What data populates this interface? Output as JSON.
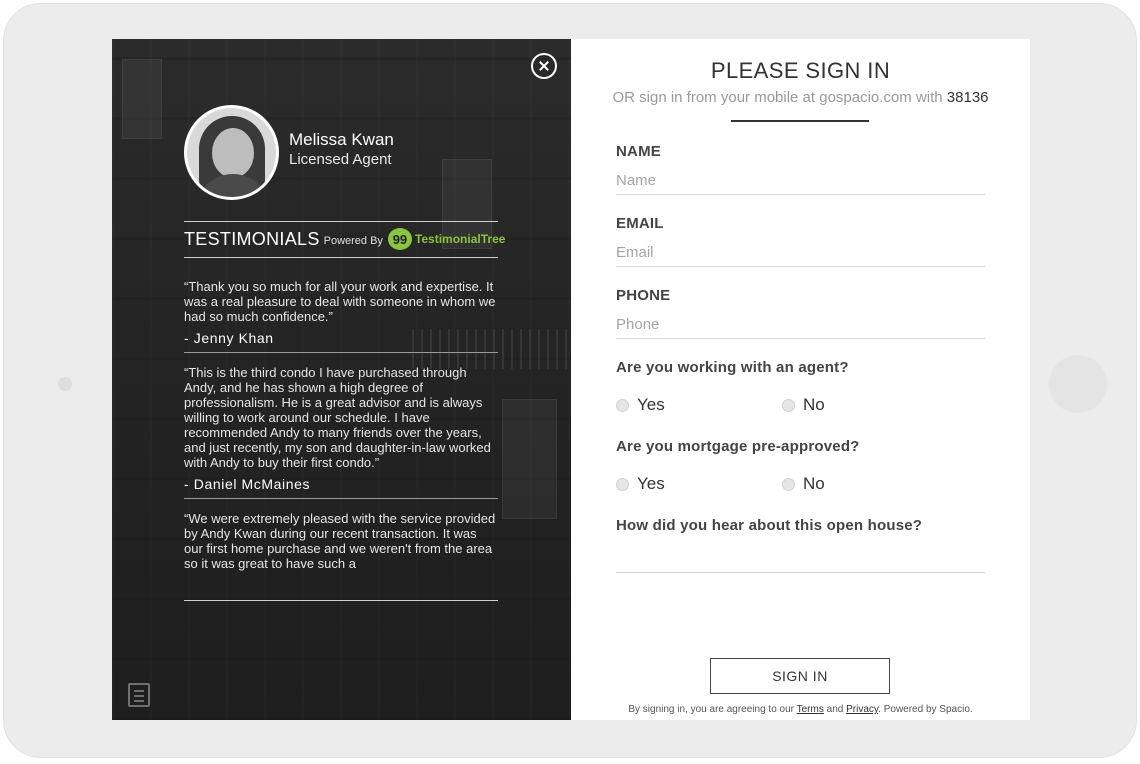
{
  "agent": {
    "name": "Melissa Kwan",
    "title": "Licensed Agent"
  },
  "testimonials": {
    "heading": "TESTIMONIALS",
    "powered_by": "Powered By",
    "logo_glyph": "99",
    "logo_text": "TestimonialTree",
    "logo_color": "#8bc53f",
    "items": [
      {
        "text": "“Thank you so much for all your work and expertise. It was a real pleasure to deal with someone in whom we had so much confidence.”",
        "author": "- Jenny Khan"
      },
      {
        "text": "“This is the third condo I have purchased through Andy, and he has shown a high degree of professionalism. He is a great advisor and is always willing to work around our schedule. I have recommended Andy to many friends over the years, and just recently, my son and daughter-in-law worked with Andy to buy their first condo.”",
        "author": "- Daniel McMaines"
      },
      {
        "text": "“We were extremely pleased with the service provided by Andy Kwan during our recent transaction. It was our first home purchase and we weren't from the area so it was great to have such a",
        "author": ""
      }
    ]
  },
  "form": {
    "title": "PLEASE SIGN IN",
    "subtitle_prefix": "OR sign in from your mobile at gospacio.com with",
    "code": "38136",
    "name_label": "NAME",
    "name_placeholder": "Name",
    "email_label": "EMAIL",
    "email_placeholder": "Email",
    "phone_label": "PHONE",
    "phone_placeholder": "Phone",
    "agent_question": "Are you working with an agent?",
    "mortgage_question": "Are you mortgage pre-approved?",
    "yes": "Yes",
    "no": "No",
    "hear_question": "How did you hear about this open house?",
    "hear_value": "",
    "signin_label": "SIGN IN",
    "legal_prefix": "By signing in, you are agreeing to our",
    "terms": "Terms",
    "and": "and",
    "privacy": "Privacy",
    "legal_suffix": ". Powered by Spacio."
  },
  "icons": {
    "close": "close-circle-icon",
    "document": "document-icon"
  }
}
